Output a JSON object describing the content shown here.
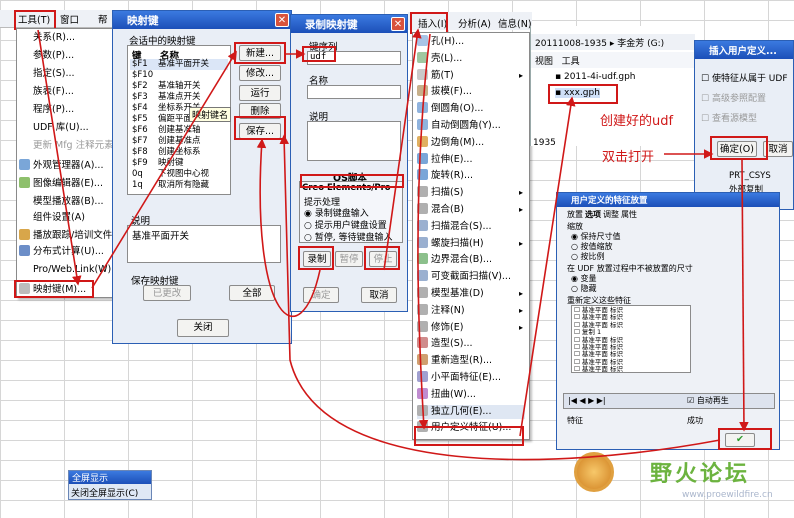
{
  "colors": {
    "annotation": "#d01818",
    "title_bar": "#2a62c8",
    "watermark_green": "#6cb33f"
  },
  "left_menu": {
    "tab_label": "工具(T)",
    "window_label": "窗口",
    "help_label": "帮",
    "items": [
      "关系(R)...",
      "参数(P)...",
      "指定(S)...",
      "族表(F)...",
      "程序(P)...",
      "UDF 库(U)...",
      "更新 Mfg 注释元素",
      "外观管理器(A)...",
      "图像编辑器(E)...",
      "模型播放器(B)...",
      "组件设置(A)",
      "播放跟踪/培训文件",
      "分布式计算(U)...",
      "Pro/Web.Link(W)",
      "映射键(M)..."
    ]
  },
  "mapkey_dialog": {
    "title": "映射键",
    "section_label": "会话中的映射键",
    "col_key": "键",
    "col_name": "名称",
    "rows": [
      {
        "key": "$F1",
        "name": "基准平面开关"
      },
      {
        "key": "$F10",
        "name": ""
      },
      {
        "key": "$F2",
        "name": "基准轴开关"
      },
      {
        "key": "$F3",
        "name": "基准点开关"
      },
      {
        "key": "$F4",
        "name": "坐标系开关"
      },
      {
        "key": "$F5",
        "name": "偏距平面"
      },
      {
        "key": "$F6",
        "name": "创建基准轴"
      },
      {
        "key": "$F7",
        "name": "创建基准点"
      },
      {
        "key": "$F8",
        "name": "创建坐标系"
      },
      {
        "key": "$F9",
        "name": "映射键"
      },
      {
        "key": "0q",
        "name": "下视图中心视"
      },
      {
        "key": "1q",
        "name": "取消所有隐藏"
      }
    ],
    "tooltip": "映射键名",
    "buttons": [
      "新建...",
      "修改...",
      "运行",
      "删除",
      "保存..."
    ],
    "desc_label": "说明",
    "desc_value": "基准平面开关",
    "save_label": "保存映射键",
    "changed_btn": "已更改",
    "all_btn": "全部",
    "close_btn": "关闭"
  },
  "record_dialog": {
    "title": "录制映射键",
    "seq_label": "键序列",
    "seq_value": "udf",
    "name_label": "名称",
    "desc_label": "说明",
    "os_label": "OS脚本",
    "creo_label": "Creo Elements/Pro",
    "prompt_label": "提示处理",
    "options": [
      "录制键盘输入",
      "提示用户键盘设置",
      "暂停, 等待键盘输入"
    ],
    "rec_btn": "录制",
    "pause_btn": "暂停",
    "stop_btn": "停止",
    "ok_btn": "确定",
    "cancel_btn": "取消"
  },
  "insert_menu": {
    "tabs": [
      "插入(I)",
      "分析(A)",
      "信息(N)"
    ],
    "items": [
      "孔(H)...",
      "壳(L)...",
      "筋(T)",
      "拔模(F)...",
      "倒圆角(O)...",
      "自动倒圆角(Y)...",
      "边倒角(M)...",
      "拉伸(E)...",
      "旋转(R)...",
      "扫描(S)",
      "混合(B)",
      "扫描混合(S)...",
      "螺旋扫描(H)",
      "边界混合(B)...",
      "可变截面扫描(V)...",
      "模型基准(D)",
      "注释(N)",
      "修饰(E)",
      "造型(S)...",
      "重新造型(R)...",
      "小平面特征(E)...",
      "扭曲(W)...",
      "独立几何(E)...",
      "用户定义特征(U)..."
    ]
  },
  "explorer": {
    "path_parts": [
      "20111008-1935",
      "李金芳",
      "(G:)"
    ],
    "view_label": "视图",
    "tools_label": "工具",
    "file1": "2011-4i-udf.gph",
    "file2": "xxx.gph",
    "side_label": "1935"
  },
  "annotations": {
    "created_udf": "创建好的udf",
    "double_click": "双击打开"
  },
  "insert_udf_dialog": {
    "title": "插入用户定义...",
    "opt1": "使特征从属于 UDF",
    "opt2": "高级参照配置",
    "opt3": "查看源模型",
    "ok": "确定(O)",
    "cancel": "取消",
    "tree_item": "PRT_CSYS",
    "tree_item2": "外部复制"
  },
  "udf_feature_dialog": {
    "title": "用户定义的特征放置",
    "tabs": [
      "放置",
      "选项",
      "调整",
      "属性"
    ],
    "row1": "缩放",
    "row2": "保持尺寸值",
    "row3": "按值缩放",
    "row4": "按比例",
    "row5": "在 UDF 放置过程中不被放置的尺寸",
    "row6": "变量",
    "row7": "隐藏",
    "row8": "重新定义这些特征",
    "list": [
      "基准平面 标识",
      "基准平面 标识",
      "基准平面 标识",
      "复制 1",
      "基准平面 标识",
      "基准平面 标识",
      "基准平面 标识",
      "基准平面 标识",
      "基准平面 标识"
    ],
    "auto_regen": "自动再生",
    "feature_label": "特征",
    "success": "成功"
  },
  "fullscreen_toolbar": {
    "title": "全屏显示",
    "close": "关闭全屏显示(C)"
  },
  "watermark": {
    "cn": "野火论坛",
    "url": "www.proewildfire.cn"
  }
}
